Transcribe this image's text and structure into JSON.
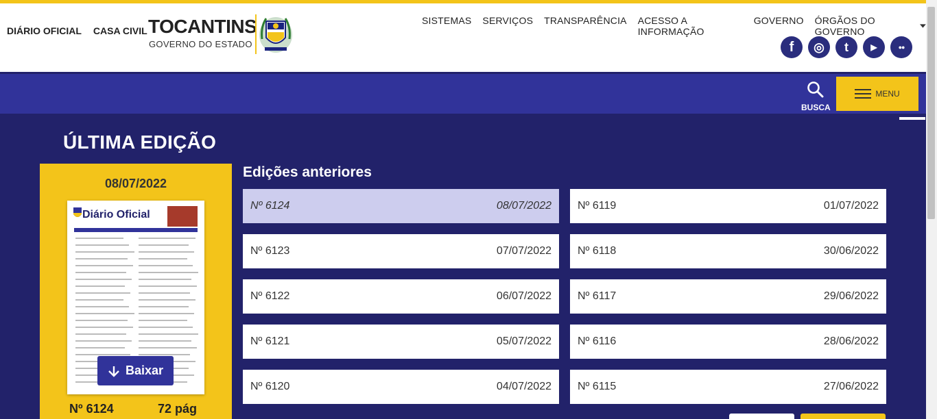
{
  "header": {
    "left_links": [
      "DIÁRIO OFICIAL",
      "CASA CIVIL"
    ],
    "brand_title": "TOCANTINS",
    "brand_subtitle": "GOVERNO DO ESTADO",
    "nav": [
      "SISTEMAS",
      "SERVIÇOS",
      "TRANSPARÊNCIA",
      "ACESSO A INFORMAÇÃO",
      "GOVERNO",
      "ÓRGÃOS DO GOVERNO"
    ],
    "social": [
      {
        "icon": "facebook-icon",
        "glyph": "f"
      },
      {
        "icon": "instagram-icon",
        "glyph": "◎"
      },
      {
        "icon": "twitter-icon",
        "glyph": "t"
      },
      {
        "icon": "youtube-icon",
        "glyph": "▶"
      },
      {
        "icon": "flickr-icon",
        "glyph": "●●"
      }
    ]
  },
  "toolbar": {
    "search_label": "BUSCA",
    "menu_label": "MENU"
  },
  "latest": {
    "heading": "ÚLTIMA EDIÇÃO",
    "date": "08/07/2022",
    "cover_title": "Diário Oficial",
    "download_label": "Baixar",
    "number": "Nº 6124",
    "pages": "72 pág"
  },
  "previous": {
    "heading": "Edições anteriores",
    "left": [
      {
        "number": "Nº 6124",
        "date": "08/07/2022",
        "selected": true
      },
      {
        "number": "Nº 6123",
        "date": "07/07/2022"
      },
      {
        "number": "Nº 6122",
        "date": "06/07/2022"
      },
      {
        "number": "Nº 6121",
        "date": "05/07/2022"
      },
      {
        "number": "Nº 6120",
        "date": "04/07/2022"
      }
    ],
    "right": [
      {
        "number": "Nº 6119",
        "date": "01/07/2022"
      },
      {
        "number": "Nº 6118",
        "date": "30/06/2022"
      },
      {
        "number": "Nº 6117",
        "date": "29/06/2022"
      },
      {
        "number": "Nº 6116",
        "date": "28/06/2022"
      },
      {
        "number": "Nº 6115",
        "date": "27/06/2022"
      }
    ]
  },
  "colors": {
    "accent": "#f3c41a",
    "primary": "#31339a",
    "background": "#22226a",
    "selected": "#cdcdee"
  }
}
